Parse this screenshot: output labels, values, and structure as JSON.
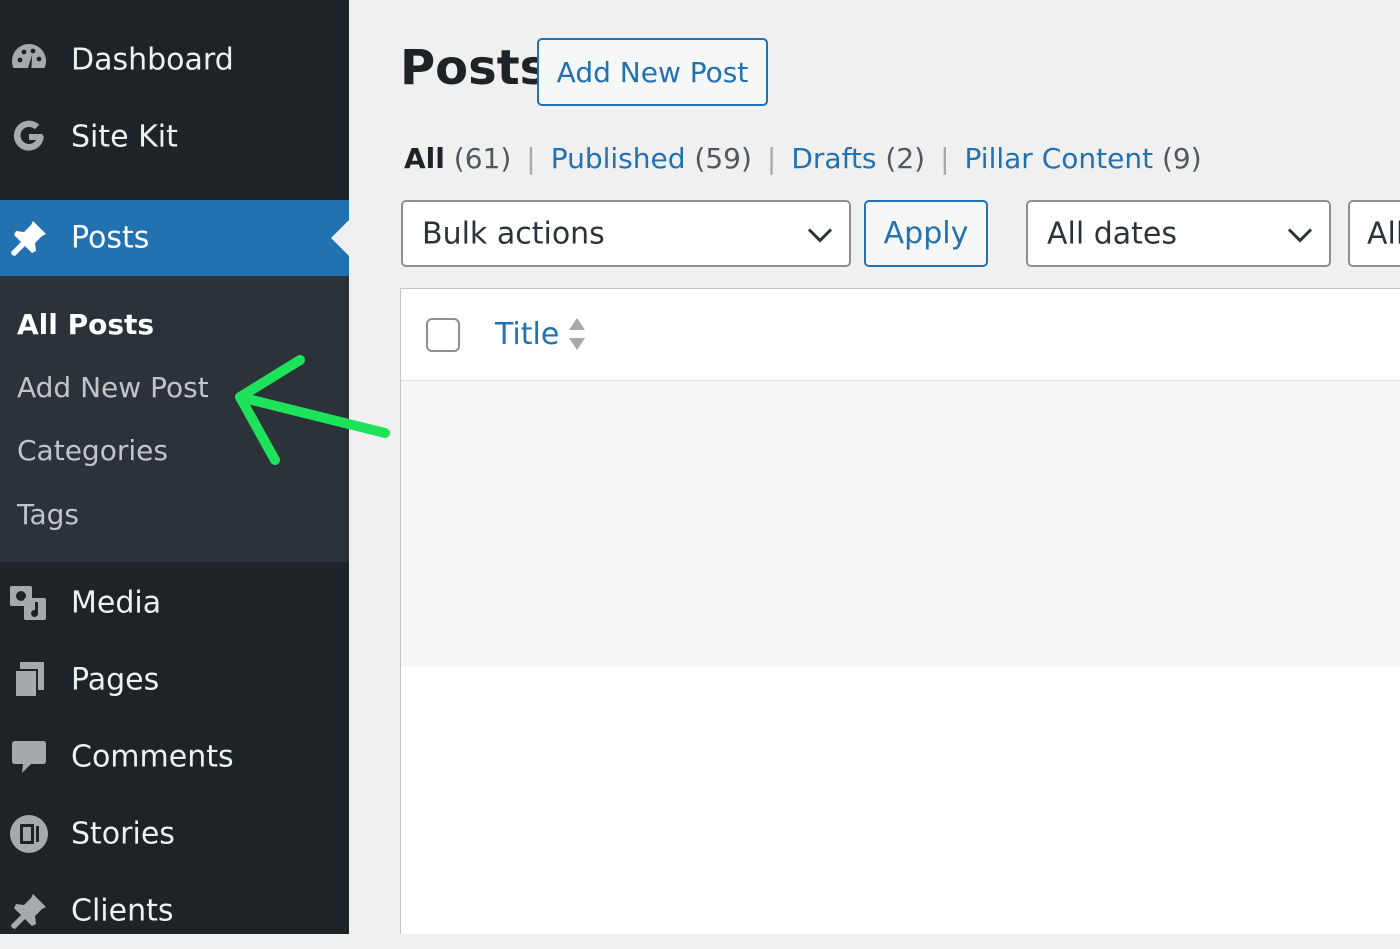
{
  "sidebar": {
    "items": [
      {
        "label": "Dashboard",
        "icon": "dashboard-icon"
      },
      {
        "label": "Site Kit",
        "icon": "google-g-icon"
      },
      {
        "label": "Posts",
        "icon": "pushpin-icon",
        "active": true
      },
      {
        "label": "Media",
        "icon": "media-icon"
      },
      {
        "label": "Pages",
        "icon": "pages-icon"
      },
      {
        "label": "Comments",
        "icon": "comment-bubble-icon"
      },
      {
        "label": "Stories",
        "icon": "stories-icon"
      },
      {
        "label": "Clients",
        "icon": "pushpin-icon"
      }
    ],
    "submenu": [
      {
        "label": "All Posts",
        "current": true
      },
      {
        "label": "Add New Post"
      },
      {
        "label": "Categories"
      },
      {
        "label": "Tags"
      }
    ]
  },
  "main": {
    "page_title": "Posts",
    "add_new_label": "Add New Post",
    "filters": [
      {
        "label": "All",
        "count": "(61)",
        "current": true
      },
      {
        "label": "Published",
        "count": "(59)"
      },
      {
        "label": "Drafts",
        "count": "(2)"
      },
      {
        "label": "Pillar Content",
        "count": "(9)"
      }
    ],
    "separator": "|",
    "bulk_actions": "Bulk actions",
    "apply_label": "Apply",
    "dates_filter": "All dates",
    "category_filter": "All",
    "table": {
      "columns": [
        "Title"
      ]
    }
  },
  "colors": {
    "sidebar_bg": "#1d2327",
    "submenu_bg": "#2c3338",
    "accent": "#2271b1",
    "annotation_arrow": "#1ee35a"
  },
  "annotation": {
    "type": "arrow",
    "points_to": "Add New Post"
  }
}
